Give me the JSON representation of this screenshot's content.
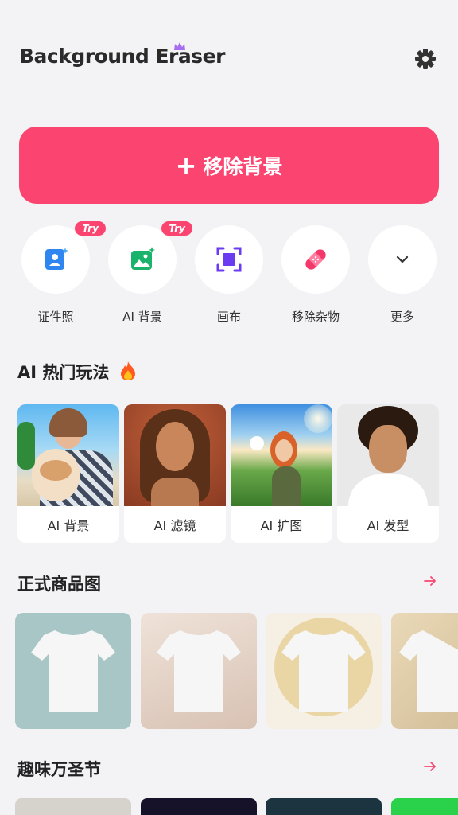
{
  "header": {
    "title": "Background Eraser",
    "settings_icon": "gear-icon"
  },
  "primary_action": {
    "label": "移除背景",
    "icon": "plus-icon"
  },
  "tools": [
    {
      "label": "证件照",
      "badge": "Try",
      "icon": "id-photo-icon"
    },
    {
      "label": "AI 背景",
      "badge": "Try",
      "icon": "ai-background-icon"
    },
    {
      "label": "画布",
      "icon": "canvas-icon"
    },
    {
      "label": "移除杂物",
      "icon": "bandage-icon"
    },
    {
      "label": "更多",
      "icon": "chevron-down-icon"
    }
  ],
  "ai_section": {
    "title": "AI 热门玩法",
    "emoji_icon": "fire-icon",
    "cards": [
      {
        "label": "AI 背景"
      },
      {
        "label": "AI 滤镜"
      },
      {
        "label": "AI 扩图"
      },
      {
        "label": "AI 发型"
      }
    ]
  },
  "product_section": {
    "title": "正式商品图",
    "arrow_icon": "arrow-right-icon"
  },
  "halloween_section": {
    "title": "趣味万圣节",
    "arrow_icon": "arrow-right-icon"
  },
  "colors": {
    "accent": "#fb4570",
    "background": "#f3f3f5"
  }
}
